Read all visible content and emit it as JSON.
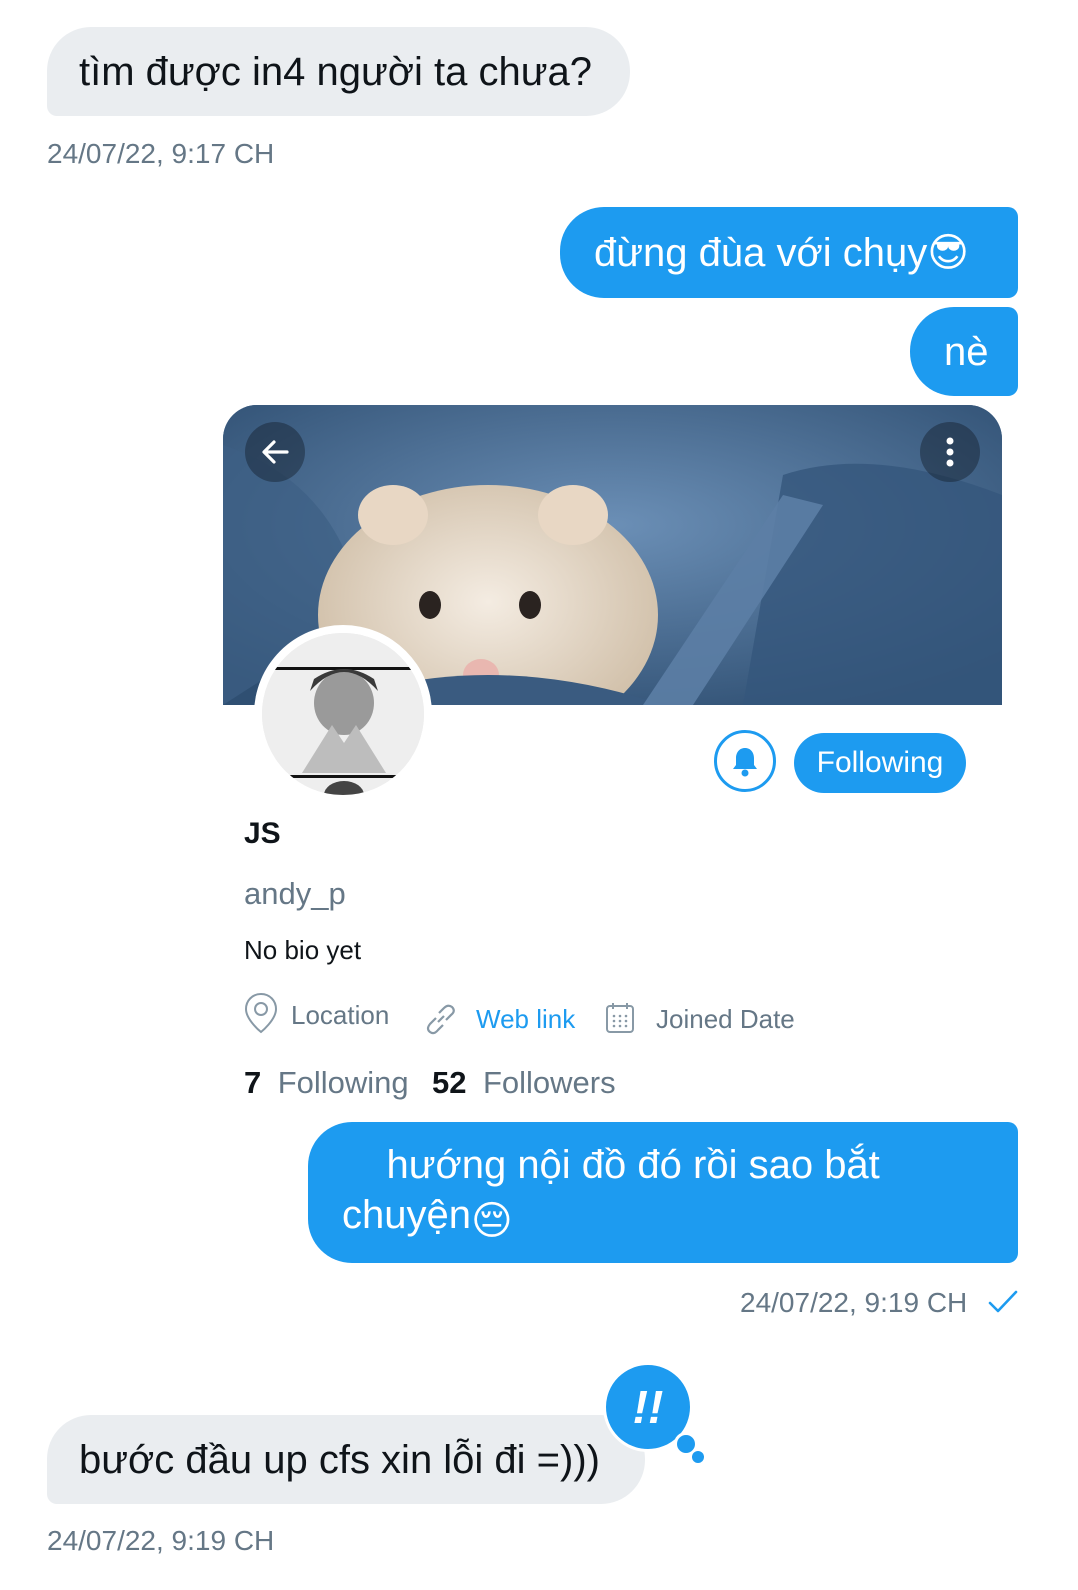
{
  "messages": [
    {
      "text": "tìm được in4 người ta chưa?",
      "time": "24/07/22, 9:17 CH"
    },
    {
      "text": "đừng đùa với chụy",
      "emoji": "😎"
    },
    {
      "text": "nè"
    },
    {
      "text": "hướng nội đồ đó rồi sao bắt chuyện",
      "emoji": "😔",
      "time": "24/07/22, 9:19 CH"
    },
    {
      "text": "bước đầu up cfs xin lỗi đi =)))",
      "time": "24/07/22, 9:19 CH"
    }
  ],
  "profile": {
    "name": "JS",
    "handle": "andy_p",
    "bio": "No bio yet",
    "location": "Location",
    "web_link": "Web link",
    "joined": "Joined Date",
    "following_count": "7",
    "following_label": "Following",
    "followers_count": "52",
    "followers_label": "Followers",
    "follow_button": "Following"
  },
  "reaction": {
    "label": "!!"
  },
  "colors": {
    "accent": "#1d9bf0",
    "incoming_bubble": "#eaedf0",
    "muted_text": "#657786"
  },
  "icons": [
    "back-arrow-icon",
    "more-vertical-icon",
    "bell-icon",
    "location-pin-icon",
    "link-icon",
    "calendar-icon",
    "check-icon"
  ]
}
